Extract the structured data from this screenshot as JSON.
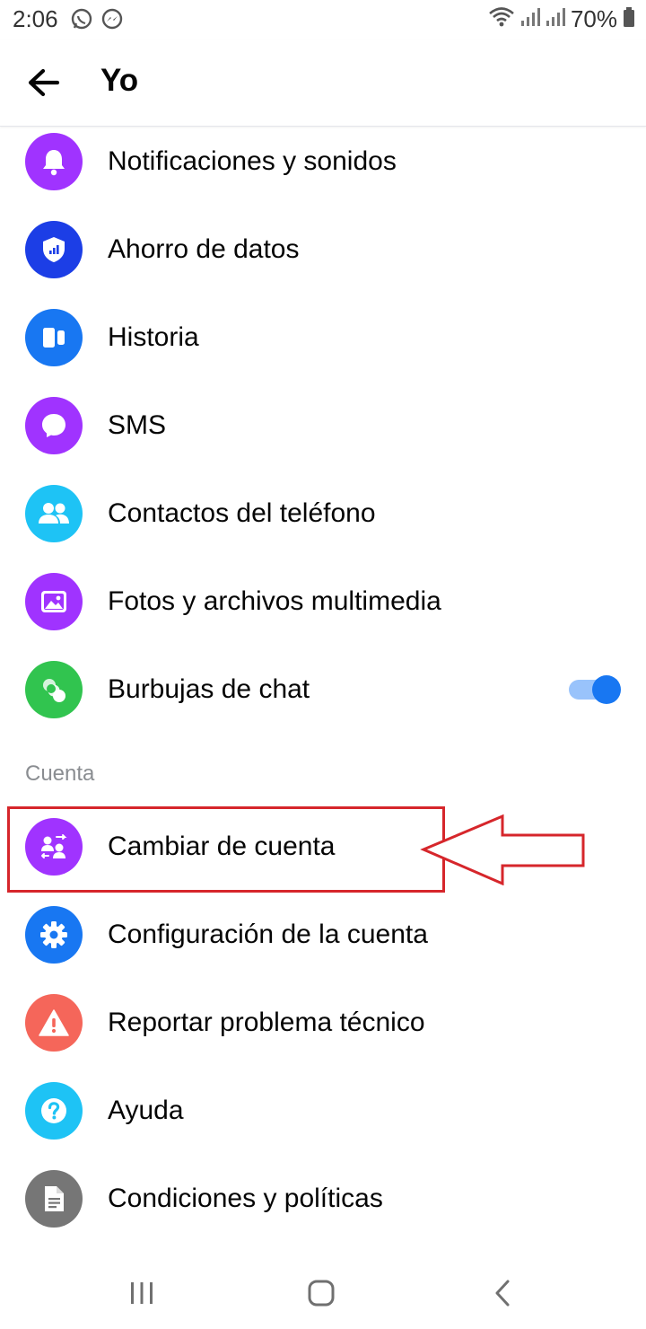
{
  "status_bar": {
    "time": "2:06",
    "battery": "70%",
    "left_icons": [
      "whatsapp-icon",
      "messenger-icon"
    ],
    "right_icons": [
      "wifi-icon",
      "signal-icon",
      "signal-icon",
      "battery-icon"
    ]
  },
  "header": {
    "back_icon": "back-arrow-icon",
    "title": "Yo"
  },
  "items_top": [
    {
      "label": "Notificaciones y sonidos",
      "icon": "bell-icon",
      "color": "#a033ff"
    },
    {
      "label": "Ahorro de datos",
      "icon": "shield-icon",
      "color": "#1c3ee6"
    },
    {
      "label": "Historia",
      "icon": "stories-icon",
      "color": "#1877f2"
    },
    {
      "label": "SMS",
      "icon": "chat-bubble-icon",
      "color": "#a033ff"
    },
    {
      "label": "Contactos del teléfono",
      "icon": "contacts-icon",
      "color": "#1ec3f5"
    },
    {
      "label": "Fotos y archivos multimedia",
      "icon": "photo-icon",
      "color": "#a033ff"
    },
    {
      "label": "Burbujas de chat",
      "icon": "chat-heads-icon",
      "color": "#31c44f",
      "toggle": true
    }
  ],
  "section_account": {
    "label": "Cuenta"
  },
  "items_account": [
    {
      "label": "Cambiar de cuenta",
      "icon": "switch-account-icon",
      "color": "#a033ff"
    },
    {
      "label": "Configuración de la cuenta",
      "icon": "gear-icon",
      "color": "#1877f2"
    },
    {
      "label": "Reportar problema técnico",
      "icon": "warning-icon",
      "color": "#f5665a"
    },
    {
      "label": "Ayuda",
      "icon": "help-icon",
      "color": "#1ec3f5"
    },
    {
      "label": "Condiciones y políticas",
      "icon": "document-icon",
      "color": "#767676"
    }
  ],
  "colors": {
    "accent": "#1877f2",
    "annotation": "#d6262b"
  },
  "nav_bar": {
    "icons": [
      "recent-apps-icon",
      "home-icon",
      "back-icon"
    ]
  }
}
